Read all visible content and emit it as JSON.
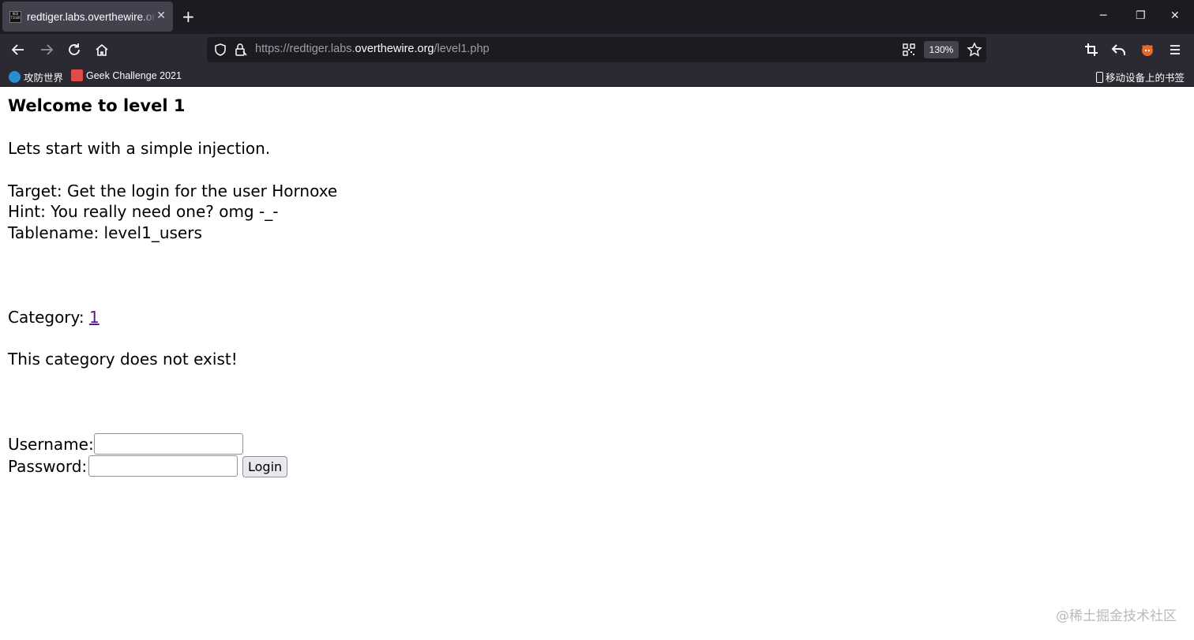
{
  "browser": {
    "tab": {
      "favicon_text": "RED TIGER",
      "title": "redtiger.labs.overthewire.org/",
      "close": "✕"
    },
    "new_tab": "+",
    "window": {
      "minimize": "─",
      "restore": "❐",
      "close": "✕"
    },
    "url": {
      "prefix": "https://redtiger.labs.",
      "host": "overthewire.org",
      "path": "/level1.php"
    },
    "zoom": "130%",
    "bookmarks": [
      {
        "label": "攻防世界",
        "icon": "globe-icon",
        "color": "#2a8dd4"
      },
      {
        "label": "Geek Challenge 2021",
        "icon": "geek-icon",
        "color": "#e04b4b"
      }
    ],
    "mobile_bookmarks": "移动设备上的书签"
  },
  "page": {
    "heading": "Welcome to level 1",
    "intro": "Lets start with a simple injection.",
    "target": "Target: Get the login for the user Hornoxe",
    "hint": "Hint: You really need one? omg -_-",
    "tablename": "Tablename: level1_users",
    "category_label": "Category: ",
    "category_link": "1",
    "message": "This category does not exist!",
    "form": {
      "username_label": "Username:",
      "username_value": "",
      "password_label": "Password:",
      "password_value": "",
      "login_button": "Login"
    }
  },
  "watermark": "@稀土掘金技术社区",
  "colors": {
    "tab_bg": "#42414d",
    "chrome_bg": "#2b2a33",
    "titlebar_bg": "#1c1b22",
    "visited_link": "#551a8b"
  }
}
